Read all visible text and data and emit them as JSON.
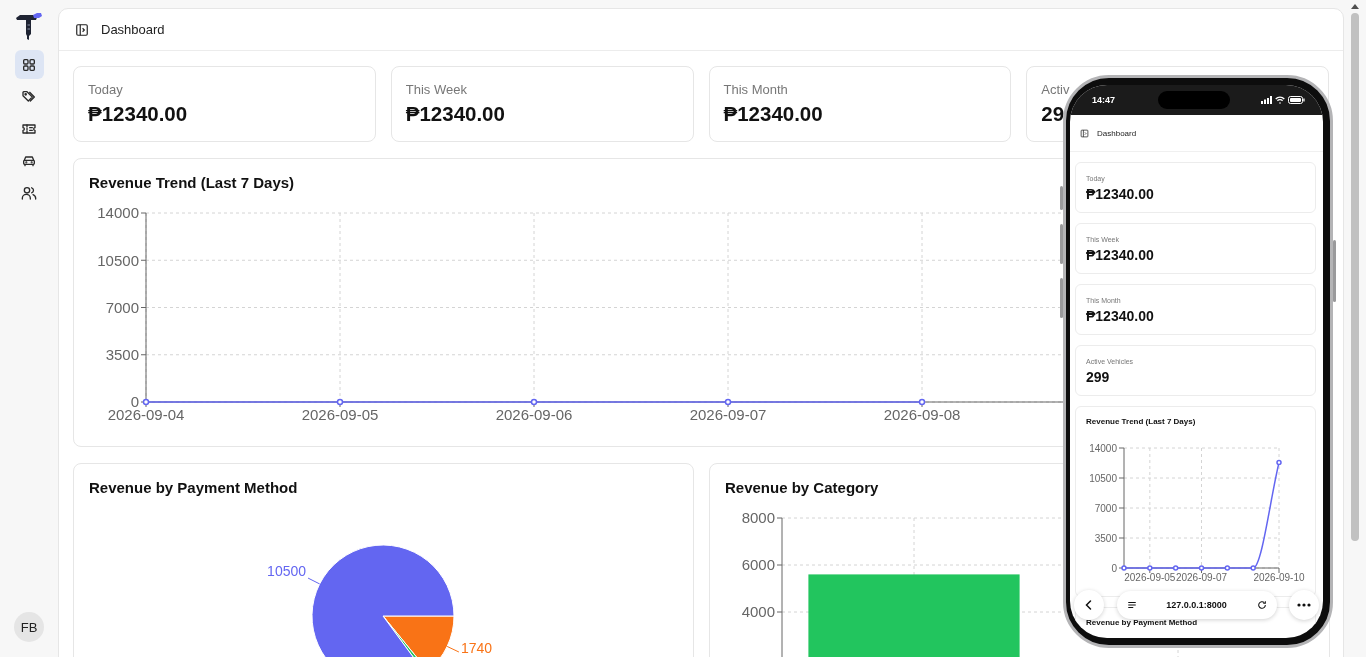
{
  "sidebar": {
    "items": [
      {
        "selected": true
      },
      {
        "selected": false
      },
      {
        "selected": false
      },
      {
        "selected": false
      },
      {
        "selected": false
      }
    ],
    "avatar": "FB"
  },
  "header": {
    "title": "Dashboard"
  },
  "stats": [
    {
      "label": "Today",
      "value": "₱12340.00"
    },
    {
      "label": "This Week",
      "value": "₱12340.00"
    },
    {
      "label": "This Month",
      "value": "₱12340.00"
    },
    {
      "label": "Activ",
      "value": "29"
    }
  ],
  "trend": {
    "title": "Revenue Trend (Last 7 Days)",
    "chart_data": {
      "type": "line",
      "categories": [
        "2026-09-04",
        "2026-09-05",
        "2026-09-06",
        "2026-09-07",
        "2026-09-08",
        null,
        null
      ],
      "series": [
        {
          "color": "#6366f1",
          "values": [
            0,
            0,
            0,
            0,
            0,
            null,
            null
          ],
          "marker": true
        }
      ],
      "ylim": [
        0,
        14000
      ],
      "yticks": [
        0,
        3500,
        7000,
        10500,
        14000
      ],
      "grid": true
    }
  },
  "payment": {
    "title": "Revenue by Payment Method",
    "chart_data": {
      "type": "pie",
      "values": [
        1740,
        100,
        10500
      ],
      "colors": [
        "#f97316",
        "#22c55e",
        "#6366f1"
      ],
      "value_labels": [
        "1740",
        null,
        "10500"
      ]
    }
  },
  "category": {
    "title": "Revenue by Category",
    "chart_data": {
      "type": "bar",
      "values": [
        5600,
        null
      ],
      "color": "#22c55e",
      "ylim": [
        0,
        8000
      ],
      "yticks": [
        4000,
        6000,
        8000
      ],
      "grid": true
    }
  },
  "phone": {
    "time": "14:47",
    "header": "Dashboard",
    "stats": [
      {
        "label": "Today",
        "value": "₱12340.00"
      },
      {
        "label": "This Week",
        "value": "₱12340.00"
      },
      {
        "label": "This Month",
        "value": "₱12340.00"
      },
      {
        "label": "Active Vehicles",
        "value": "299"
      }
    ],
    "trend": {
      "title": "Revenue Trend (Last 7 Days)",
      "chart_data": {
        "type": "line",
        "categories": [
          null,
          "2026-09-05",
          null,
          "2026-09-07",
          null,
          null,
          "2026-09-10"
        ],
        "series": [
          {
            "color": "#6366f1",
            "values": [
              0,
              0,
              0,
              0,
              0,
              0,
              12300
            ],
            "marker": true
          }
        ],
        "ylim": [
          0,
          14000
        ],
        "yticks": [
          0,
          3500,
          7000,
          10500,
          14000
        ],
        "grid": true
      }
    },
    "url": "127.0.0.1:8000",
    "next_title": "Revenue by Payment Method"
  }
}
